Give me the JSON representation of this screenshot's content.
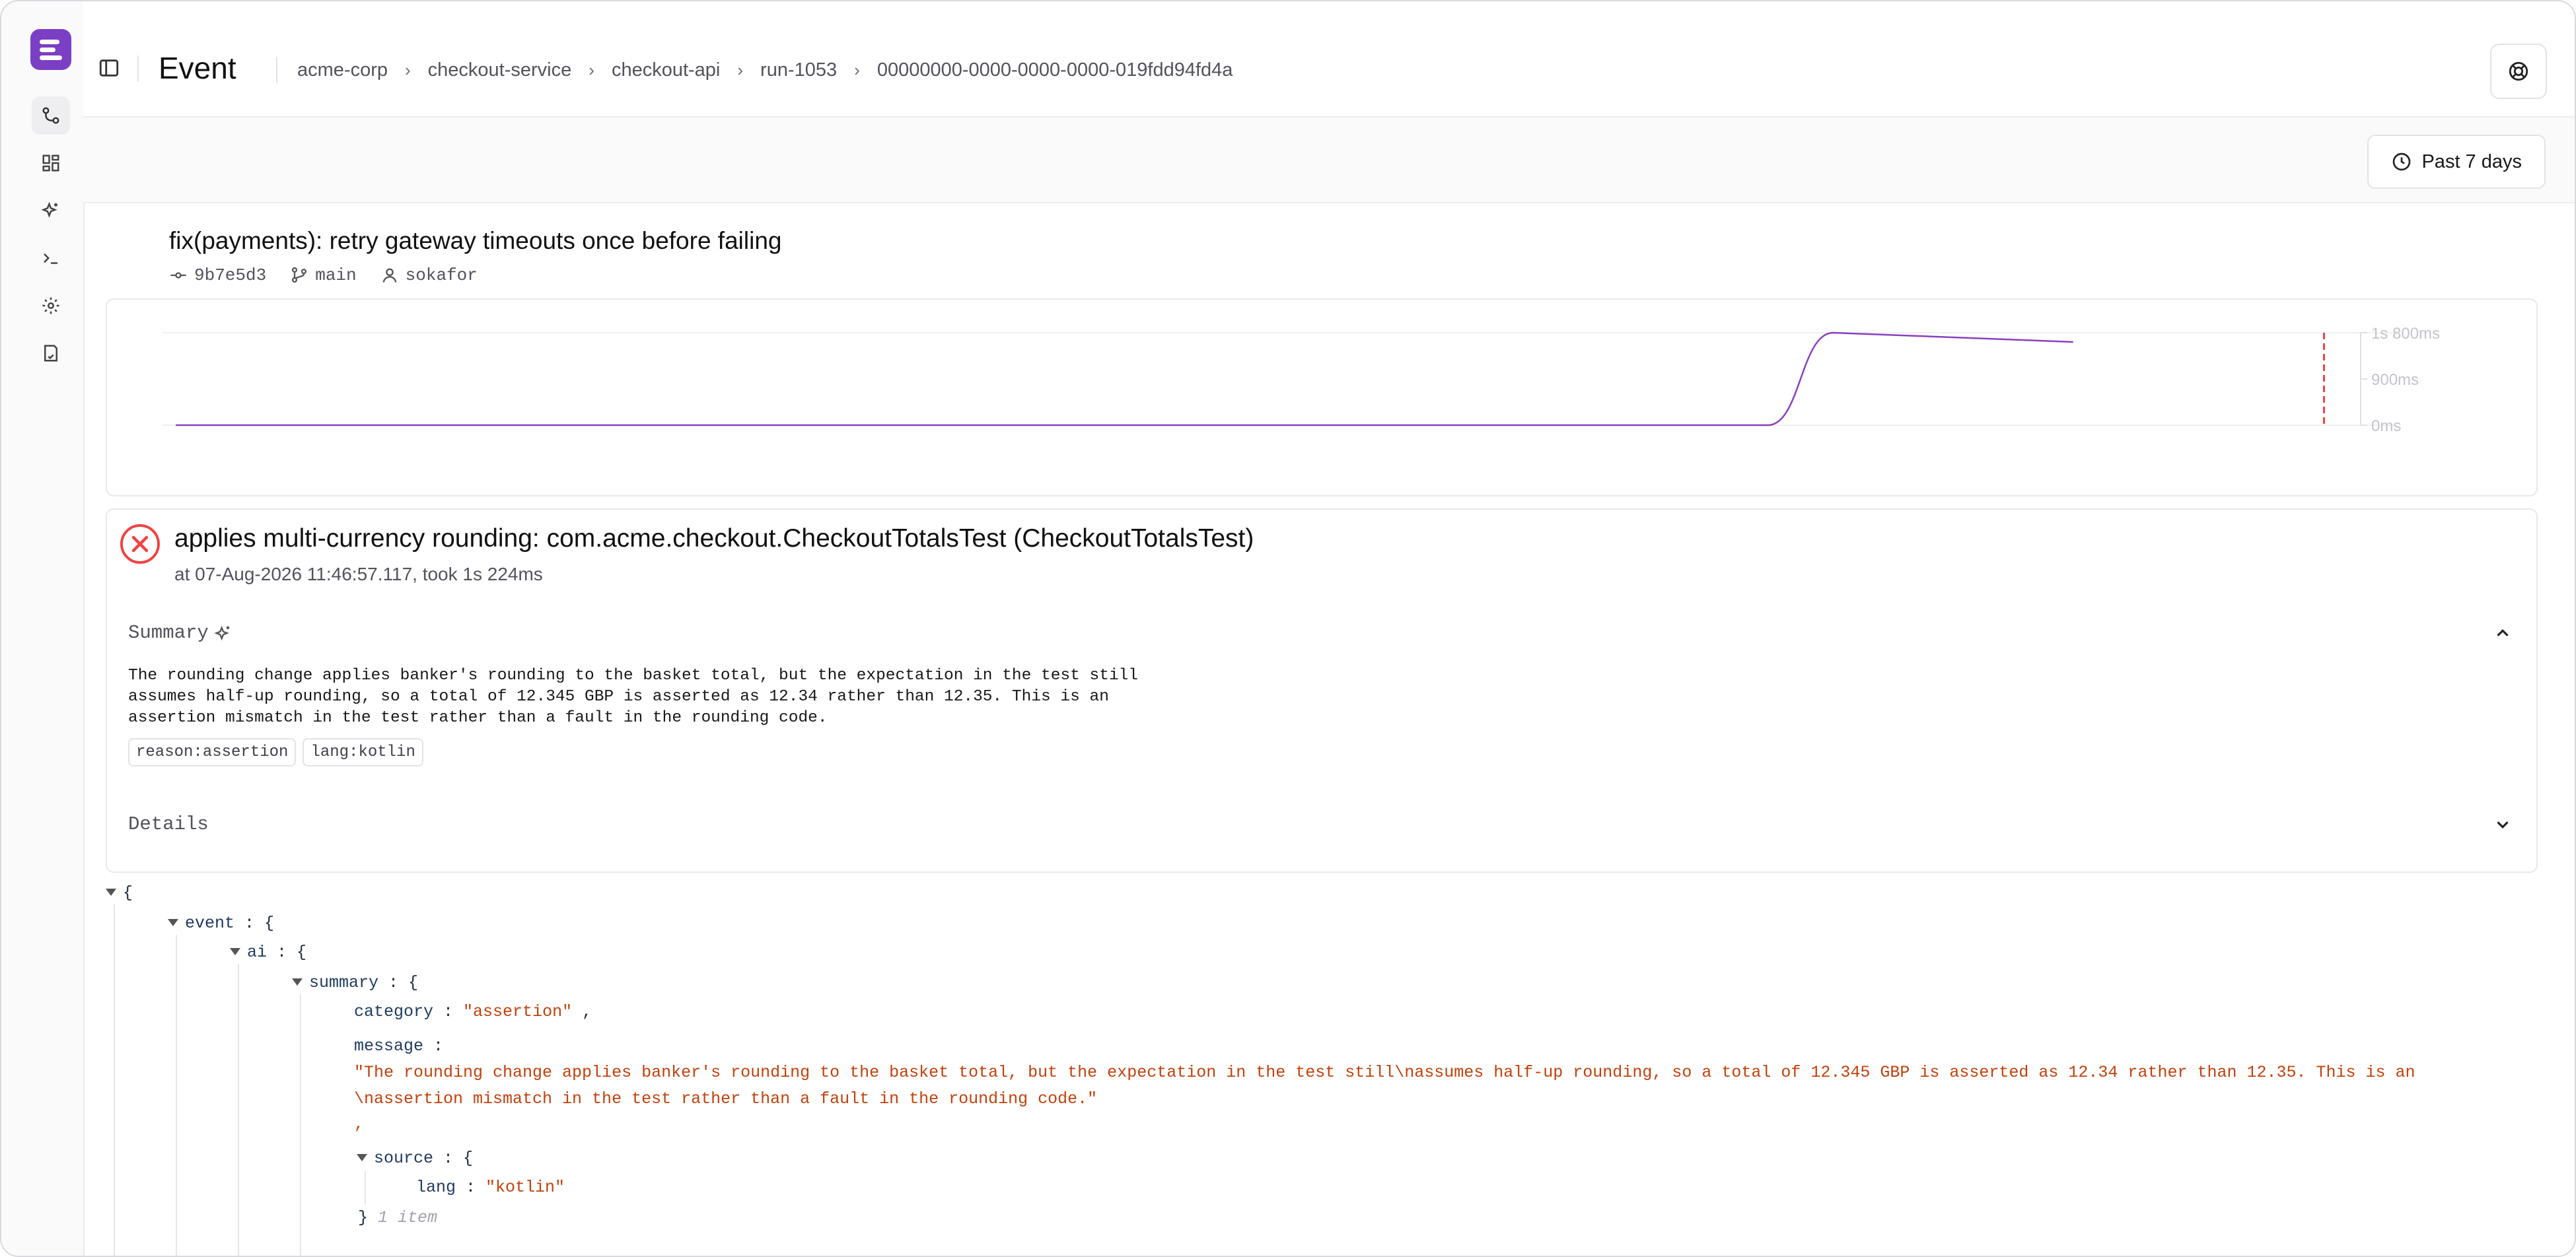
{
  "nav": {
    "items": [
      {
        "name": "runs",
        "icon": "git-commit-icon"
      },
      {
        "name": "dashboards",
        "icon": "grid-icon"
      },
      {
        "name": "insights",
        "icon": "sparkles-icon"
      },
      {
        "name": "terminal",
        "icon": "terminal-icon"
      },
      {
        "name": "settings",
        "icon": "gear-icon"
      },
      {
        "name": "docs",
        "icon": "document-icon"
      }
    ]
  },
  "header": {
    "title": "Event",
    "breadcrumbs": [
      "acme-corp",
      "checkout-service",
      "checkout-api",
      "run-1053",
      "00000000-0000-0000-0000-019fdd94fd4a"
    ]
  },
  "toolbar": {
    "time_range": "Past 7 days"
  },
  "commit": {
    "message": "fix(payments): retry gateway timeouts once before failing",
    "sha": "9b7e5d3",
    "branch": "main",
    "author": "sokafor"
  },
  "chart_data": {
    "type": "line",
    "ytick_labels": [
      "1s 800ms",
      "900ms",
      "0ms"
    ],
    "ylim_ms": [
      0,
      1800
    ],
    "series": [
      {
        "points": [
          {
            "x": 0.0,
            "y": 0
          },
          {
            "x": 0.73,
            "y": 0
          },
          {
            "x": 0.76,
            "y": 1800
          },
          {
            "x": 0.87,
            "y": 1620
          }
        ]
      }
    ],
    "marker_x": 0.985,
    "marker_color": "#ef4444",
    "line_color": "#8b3fbf"
  },
  "event": {
    "title": "applies multi-currency rounding: com.acme.checkout.CheckoutTotalsTest (CheckoutTotalsTest)",
    "subtitle": "at 07-Aug-2026 11:46:57.117, took 1s 224ms",
    "summary_label": "Summary",
    "summary_lines": [
      "The rounding change applies banker's rounding to the basket total, but the expectation in the test still",
      "assumes half-up rounding, so a total of 12.345 GBP is asserted as 12.34 rather than 12.35. This is an",
      "assertion mismatch in the test rather than a fault in the rounding code."
    ],
    "tags": [
      "reason:assertion",
      "lang:kotlin"
    ],
    "details_label": "Details"
  },
  "json_tree": {
    "open_brace": "{",
    "event_key": "event",
    "ai_key": "ai",
    "summary_key": "summary",
    "category_key": "category",
    "category_value": "\"assertion\"",
    "message_key": "message",
    "message_line1": "\"The rounding change applies banker's rounding to the basket total, but the expectation in the test still\\nassumes half-up rounding, so a total of 12.345 GBP is asserted as 12.34 rather than 12.35. This is an",
    "message_line2": "\\nassertion mismatch in the test rather than a fault in the rounding code.\"",
    "source_key": "source",
    "lang_key": "lang",
    "lang_value": "\"kotlin\"",
    "close_count": "1 item"
  }
}
